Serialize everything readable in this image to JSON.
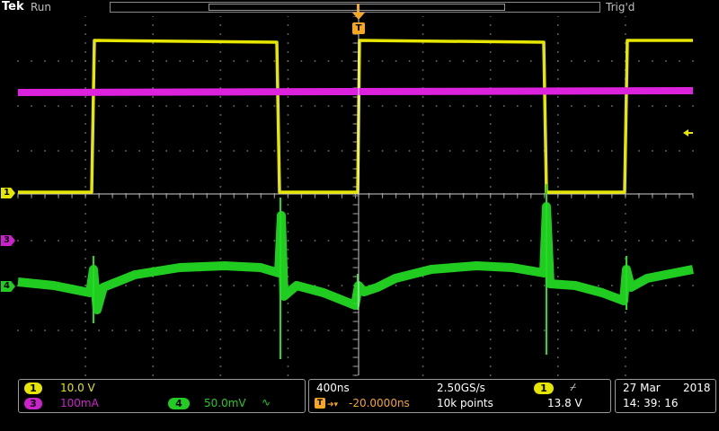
{
  "header": {
    "brand": "Tek",
    "status": "Run",
    "trigger_state": "Trig'd",
    "trigger_marker": "T"
  },
  "channels": [
    {
      "number": "1",
      "scale": "10.0 V",
      "color": "#e6e600"
    },
    {
      "number": "3",
      "scale": "100mA",
      "color": "#cc22cc"
    },
    {
      "number": "4",
      "scale": "50.0mV",
      "color": "#22cc22",
      "bandwidth_symbol": "∿"
    }
  ],
  "timebase": {
    "horizontal_scale": "400ns",
    "sample_rate": "2.50GS/s",
    "trigger_position": "-20.0000ns",
    "record_length": "10k points"
  },
  "trigger": {
    "source": "1",
    "slope_symbol": "⌿",
    "level": "13.8 V"
  },
  "datetime": {
    "date": "27 Mar",
    "year": "2018",
    "time": "14: 39: 16"
  },
  "colors": {
    "ch1": "#e6e600",
    "ch3": "#dd22dd",
    "ch4": "#22dd22",
    "trigger": "#f5a623",
    "grid": "#6e6e6e"
  }
}
